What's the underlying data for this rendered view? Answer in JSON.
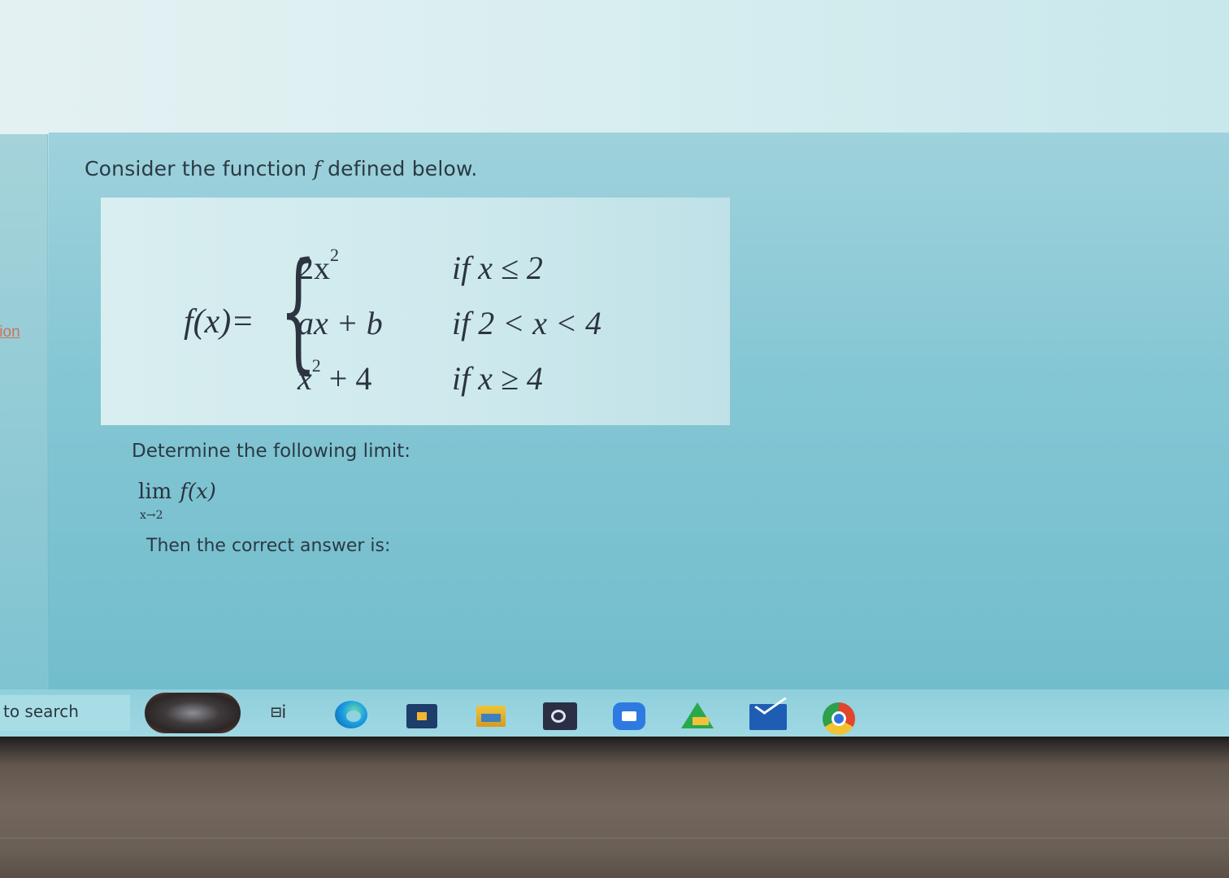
{
  "sidebar": {
    "partial_label": "tion"
  },
  "question": {
    "intro_before": "Consider the function ",
    "intro_var": "f",
    "intro_after": " defined below.",
    "function_label": "f(x)=",
    "cases": [
      {
        "expression": "2x",
        "exponent": "2",
        "condition": "if  x ≤ 2"
      },
      {
        "expression": "ax + b",
        "exponent": "",
        "condition": "if  2 < x < 4"
      },
      {
        "expression": "x",
        "exponent": "2",
        "expression_tail": " + 4",
        "condition": "if  x ≥ 4"
      }
    ],
    "determine_text": "Determine the following limit:",
    "limit_word": "lim",
    "limit_function": "f(x)",
    "limit_subscript": "x→2",
    "answer_prompt": "Then the correct answer is:"
  },
  "taskbar": {
    "search_text": "to search",
    "icons": [
      "search-highlight",
      "task-view-icon",
      "edge-icon",
      "store-icon",
      "file-explorer-icon",
      "app-icon",
      "zoom-icon",
      "drive-icon",
      "mail-icon",
      "chrome-icon"
    ],
    "taskview_glyph": "⊟ⅰ"
  }
}
